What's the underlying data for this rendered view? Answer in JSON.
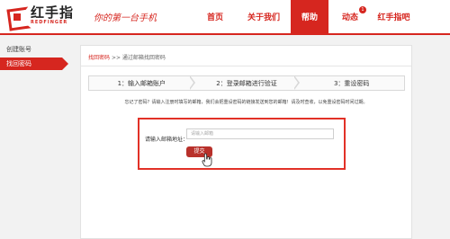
{
  "brand": {
    "name": "红手指",
    "english": "REDFINGER",
    "slogan": "你的第一台手机"
  },
  "nav": {
    "items": [
      "首页",
      "关于我们",
      "帮助",
      "动态",
      "红手指吧"
    ],
    "active_index": 2,
    "badge_text": "1"
  },
  "colors": {
    "accent": "#d6261f",
    "background": "#f2f2f2"
  },
  "sidebar": {
    "items": [
      "创建账号",
      "找回密码"
    ],
    "active_index": 1
  },
  "breadcrumb": {
    "root": "找回密码",
    "separator": ">>",
    "current": "通过邮箱找回密码"
  },
  "steps": [
    "1：输入邮箱账户",
    "2：登录邮箱进行验证",
    "3：重设密码"
  ],
  "instruction": "忘记了密码？请输入注册时填写的邮箱，我们会把重设密码的链接发送到您的邮箱！请及时查收，以免重设密码时间过期。",
  "form": {
    "label": "请输入邮箱地址：",
    "placeholder": "请输入邮箱",
    "submit_label": "提交"
  },
  "icons": {
    "cursor": "hand-pointer-icon",
    "logo": "redfinger-logo-icon"
  }
}
